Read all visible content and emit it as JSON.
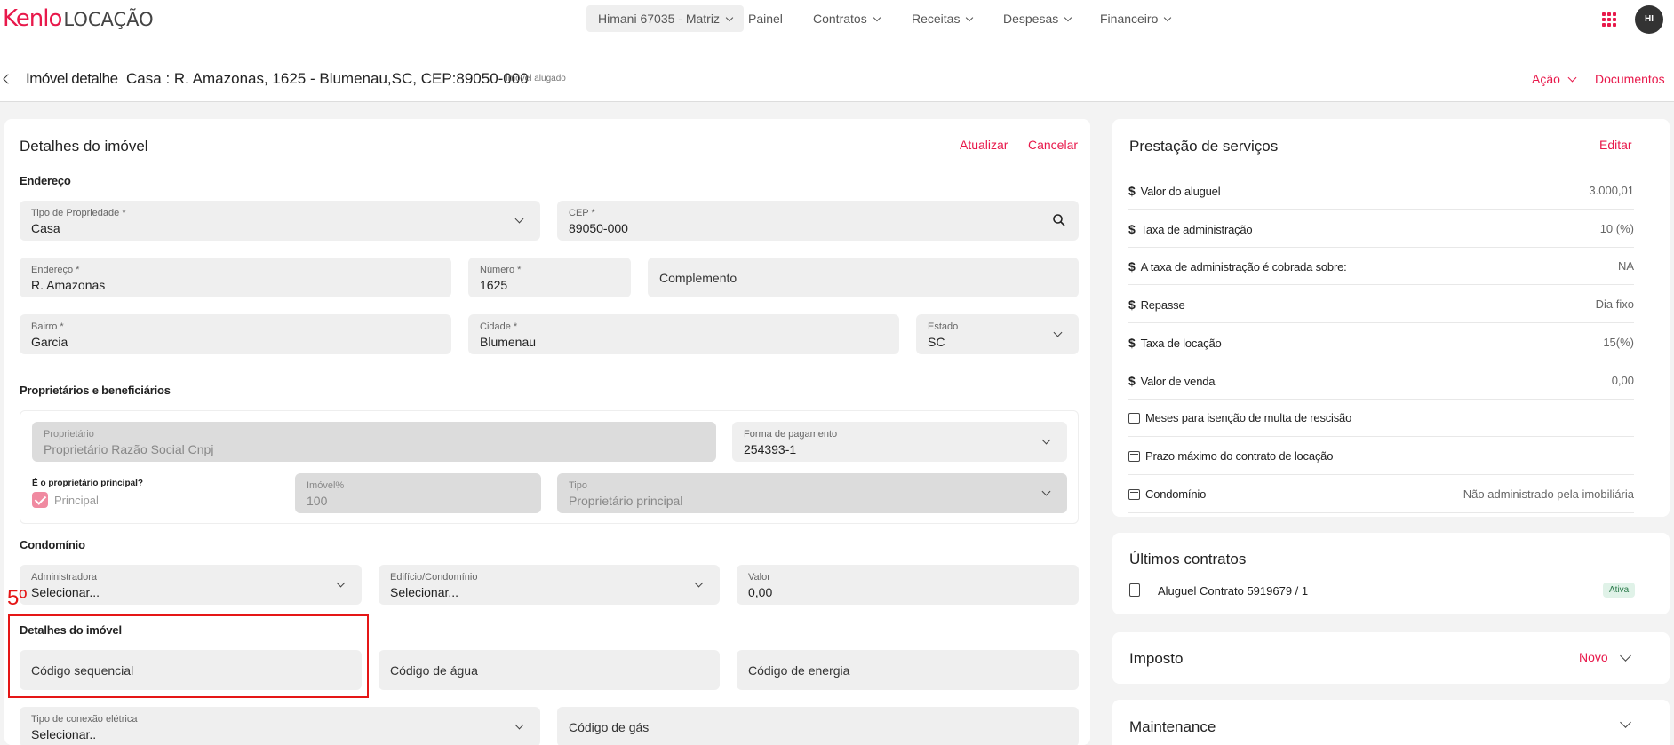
{
  "brand": {
    "name": "Kenlo",
    "product": "LOCAÇÃO"
  },
  "nav": {
    "branch": "Himani 67035 - Matriz",
    "painel": "Painel",
    "contratos": "Contratos",
    "receitas": "Receitas",
    "despesas": "Despesas",
    "financeiro": "Financeiro"
  },
  "user": {
    "initials": "HI"
  },
  "header": {
    "label": "Imóvel detalhe",
    "address": "Casa : R. Amazonas, 1625 - Blumenau,SC, CEP:89050-000",
    "status": "Imóvel alugado",
    "acao": "Ação",
    "documentos": "Documentos"
  },
  "details": {
    "title": "Detalhes do imóvel",
    "atualizar": "Atualizar",
    "cancelar": "Cancelar",
    "endereco_section": "Endereço",
    "tipo_label": "Tipo de Propriedade *",
    "tipo_value": "Casa",
    "cep_label": "CEP *",
    "cep_value": "89050-000",
    "endereco_label": "Endereço *",
    "endereco_value": "R. Amazonas",
    "numero_label": "Número *",
    "numero_value": "1625",
    "complemento_placeholder": "Complemento",
    "bairro_label": "Bairro *",
    "bairro_value": "Garcia",
    "cidade_label": "Cidade *",
    "cidade_value": "Blumenau",
    "estado_label": "Estado",
    "estado_value": "SC",
    "owners_section": "Proprietários e beneficiários",
    "proprietario_label": "Proprietário",
    "proprietario_value": "Proprietário Razão Social Cnpj",
    "pagamento_label": "Forma de pagamento",
    "pagamento_value": "254393-1",
    "principal_q": "É o proprietário principal?",
    "principal_label": "Principal",
    "imovel_pct_label": "Imóvel%",
    "imovel_pct_value": "100",
    "tipo_owner_label": "Tipo",
    "tipo_owner_value": "Proprietário principal",
    "condominio_section": "Condomínio",
    "administradora_label": "Administradora",
    "administradora_value": "Selecionar...",
    "edificio_label": "Edifício/Condomínio",
    "edificio_value": "Selecionar...",
    "valor_label": "Valor",
    "valor_value": "0,00",
    "annotation": "5º",
    "detalhes_section": "Detalhes do imóvel",
    "codigo_seq": "Código sequencial",
    "codigo_agua": "Código de água",
    "codigo_energia": "Código de energia",
    "conexao_label": "Tipo de conexão elétrica",
    "conexao_value": "Selecionar..",
    "codigo_gas": "Código de gás"
  },
  "services": {
    "title": "Prestação de serviços",
    "editar": "Editar",
    "rows": [
      {
        "label": "Valor do aluguel",
        "value": "3.000,01",
        "icon": "dollar"
      },
      {
        "label": "Taxa de administração",
        "value": "10 (%)",
        "icon": "dollar"
      },
      {
        "label": "A taxa de administração é cobrada sobre:",
        "value": "NA",
        "icon": "dollar"
      },
      {
        "label": "Repasse",
        "value": "Dia fixo",
        "icon": "dollar"
      },
      {
        "label": "Taxa de locação",
        "value": "15(%)",
        "icon": "dollar"
      },
      {
        "label": "Valor de venda",
        "value": "0,00",
        "icon": "dollar"
      },
      {
        "label": "Meses para isenção de multa de rescisão",
        "value": "",
        "icon": "calendar"
      },
      {
        "label": "Prazo máximo do contrato de locação",
        "value": "",
        "icon": "calendar"
      },
      {
        "label": "Condomínio",
        "value": "Não administrado pela imobiliária",
        "icon": "calendar"
      }
    ]
  },
  "contracts": {
    "title": "Últimos contratos",
    "item": "Aluguel Contrato 5919679 / 1",
    "status": "Ativa"
  },
  "imposto": {
    "title": "Imposto",
    "novo": "Novo"
  },
  "maintenance": {
    "title": "Maintenance"
  }
}
